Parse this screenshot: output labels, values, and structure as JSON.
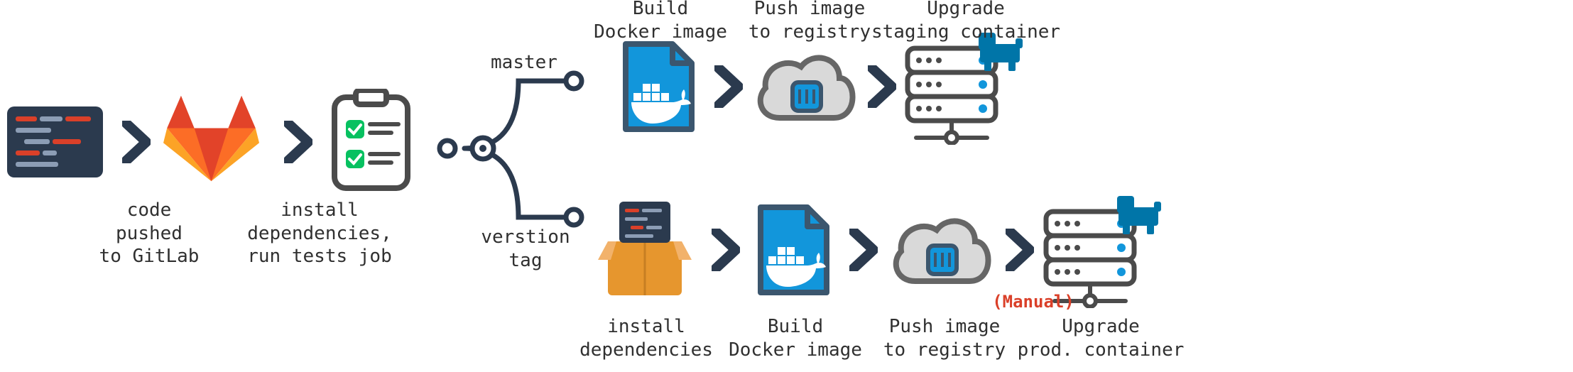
{
  "labels": {
    "push": "code\npushed\nto GitLab",
    "install": "install\ndependencies,\nrun tests job",
    "branch_master": "master",
    "branch_tag": "verstion\ntag",
    "m_build": "Build\nDocker image",
    "m_push": "Push image\nto registry",
    "m_upgrade": "Upgrade\nstaging container",
    "t_install": "install\ndependencies",
    "t_build": "Build\nDocker image",
    "t_push": "Push image\nto registry",
    "t_upgrade": "Upgrade\nprod. container",
    "manual": "(Manual)"
  },
  "colors": {
    "whale": "#1296db",
    "dark": "#2b3a4e",
    "cloud": "#bfbfbf",
    "box": "#e6962e",
    "rancher": "#0075a8",
    "check": "#07c160"
  }
}
